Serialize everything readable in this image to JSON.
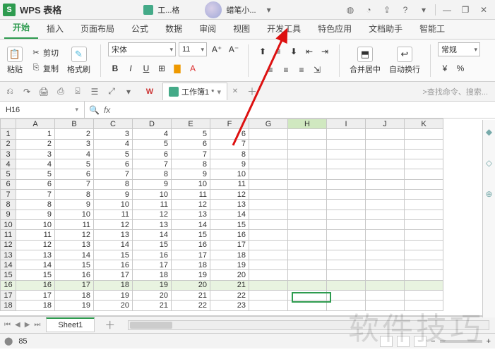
{
  "titlebar": {
    "app_name": "WPS 表格",
    "doc_short": "工...格",
    "user_name": "蜡笔小...",
    "icons": {
      "globe": "◍",
      "cloud": "◔",
      "share": "⇪",
      "help": "?",
      "drop": "▾",
      "min": "—",
      "restore": "❐",
      "close": "✕"
    }
  },
  "menu": {
    "tabs": [
      "开始",
      "插入",
      "页面布局",
      "公式",
      "数据",
      "审阅",
      "视图",
      "开发工具",
      "特色应用",
      "文档助手",
      "智能工"
    ],
    "active_index": 0
  },
  "ribbon": {
    "paste": "粘贴",
    "cut": "剪切",
    "copy": "复制",
    "format_painter": "格式刷",
    "font_name": "宋体",
    "font_size": "11",
    "merge_center": "合并居中",
    "wrap_text": "自动换行",
    "number_format": "常规"
  },
  "qat": {
    "icons": [
      "⎌",
      "↷",
      "🖨",
      "⎙",
      "⍄",
      "☰",
      "⤢",
      "▾"
    ],
    "wps": "W",
    "doc_tab_label": "工作簿1 *",
    "search_hint": ">查找命令、搜索..."
  },
  "fxbar": {
    "namebox": "H16",
    "fx": "fx"
  },
  "columns": [
    "A",
    "B",
    "C",
    "D",
    "E",
    "F",
    "G",
    "H",
    "I",
    "J",
    "K"
  ],
  "highlight_row": 16,
  "highlight_col": "H",
  "rows": [
    [
      1,
      2,
      3,
      4,
      5,
      6
    ],
    [
      2,
      3,
      4,
      5,
      6,
      7
    ],
    [
      3,
      4,
      5,
      6,
      7,
      8
    ],
    [
      4,
      5,
      6,
      7,
      8,
      9
    ],
    [
      5,
      6,
      7,
      8,
      9,
      10
    ],
    [
      6,
      7,
      8,
      9,
      10,
      11
    ],
    [
      7,
      8,
      9,
      10,
      11,
      12
    ],
    [
      8,
      9,
      10,
      11,
      12,
      13
    ],
    [
      9,
      10,
      11,
      12,
      13,
      14
    ],
    [
      10,
      11,
      12,
      13,
      14,
      15
    ],
    [
      11,
      12,
      13,
      14,
      15,
      16
    ],
    [
      12,
      13,
      14,
      15,
      16,
      17
    ],
    [
      13,
      14,
      15,
      16,
      17,
      18
    ],
    [
      14,
      15,
      16,
      17,
      18,
      19
    ],
    [
      15,
      16,
      17,
      18,
      19,
      20
    ],
    [
      16,
      17,
      18,
      19,
      20,
      21
    ],
    [
      17,
      18,
      19,
      20,
      21,
      22
    ],
    [
      18,
      19,
      20,
      21,
      22,
      23
    ]
  ],
  "sheet_tabs": {
    "active": "Sheet1"
  },
  "status": {
    "sum_label": "85"
  },
  "watermark": "软件技巧"
}
